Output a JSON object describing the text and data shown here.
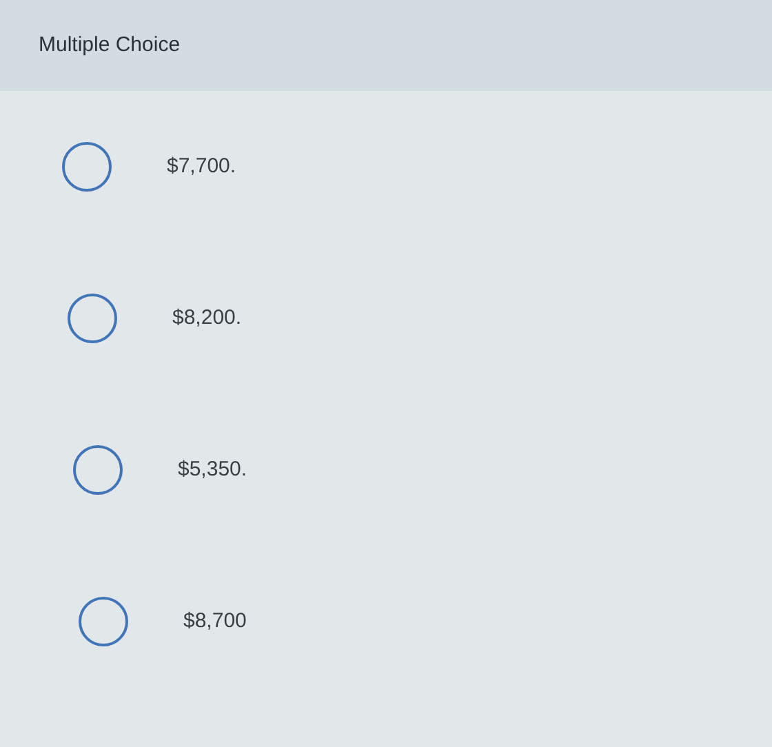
{
  "header": {
    "title": "Multiple Choice"
  },
  "options": [
    {
      "label": "$7,700.",
      "selected": false
    },
    {
      "label": "$8,200.",
      "selected": false
    },
    {
      "label": "$5,350.",
      "selected": false
    },
    {
      "label": "$8,700",
      "selected": false
    }
  ]
}
